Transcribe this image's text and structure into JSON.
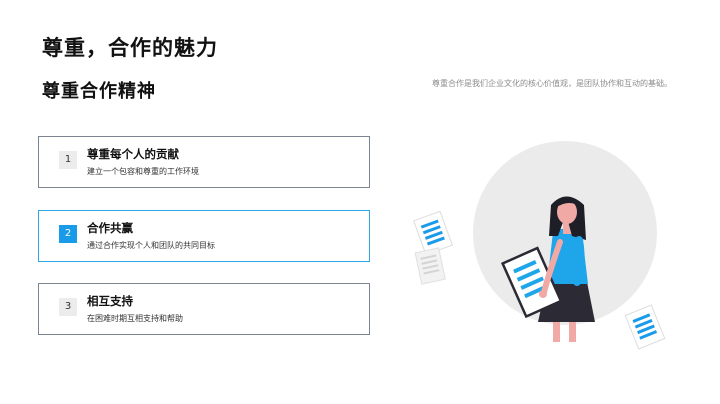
{
  "slide": {
    "title": "尊重，合作的魅力",
    "subtitle": "尊重合作精神",
    "description": "尊重合作是我们企业文化的核心价值观，是团队协作和互动的基础。",
    "cards": [
      {
        "num": "1",
        "title": "尊重每个人的贡献",
        "desc": "建立一个包容和尊重的工作环境",
        "active": false
      },
      {
        "num": "2",
        "title": "合作共赢",
        "desc": "通过合作实现个人和团队的共同目标",
        "active": true
      },
      {
        "num": "3",
        "title": "相互支持",
        "desc": "在困难时期互相支持和帮助",
        "active": false
      }
    ]
  },
  "colors": {
    "accent": "#1a9bea",
    "accent_border": "#2da8e6",
    "card_border": "#7b8591",
    "circle": "#ebebeb",
    "shirt": "#1fa5ea",
    "skirt": "#2b2a35",
    "skin": "#f0a9a4",
    "hair": "#1e1e26"
  },
  "illustration": {
    "icon": "woman-holding-document-icon"
  }
}
